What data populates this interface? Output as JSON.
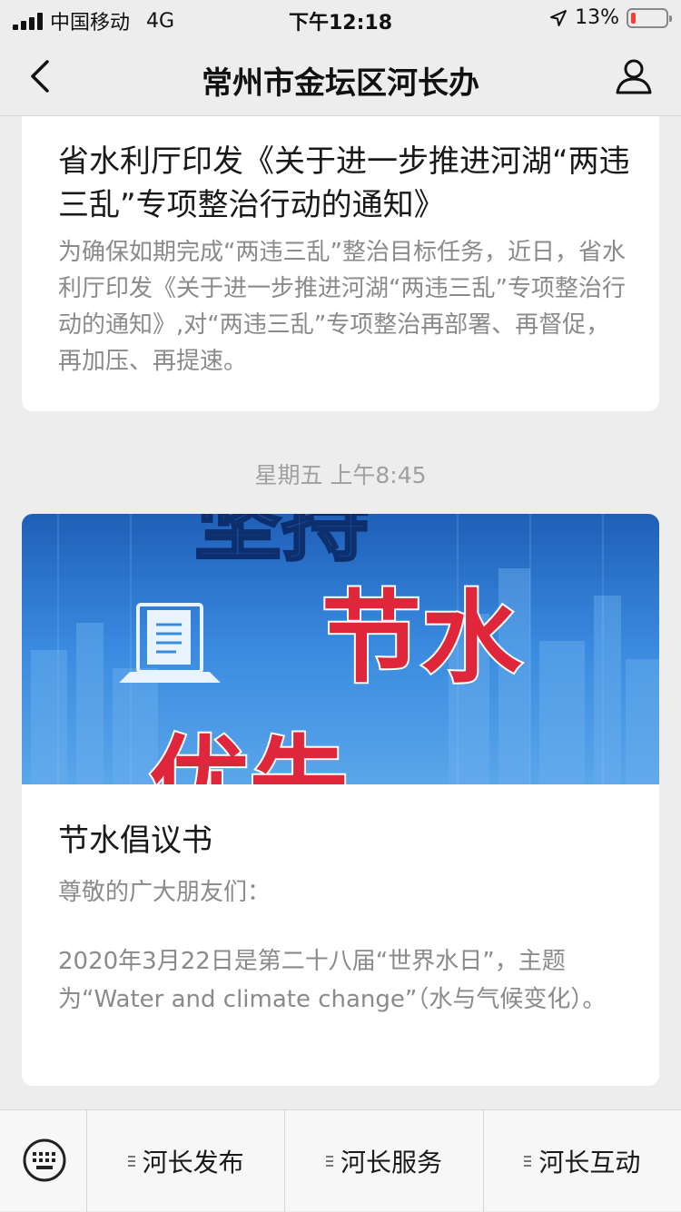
{
  "status_bar": {
    "carrier": "中国移动",
    "network": "4G",
    "time": "下午12:18",
    "battery": "13%",
    "battery_level": 0.13
  },
  "nav": {
    "title": "常州市金坛区河长办",
    "back_icon": "chevron-left-icon",
    "profile_icon": "person-icon"
  },
  "messages": [
    {
      "headline": "省水利厅印发《关于进一步推进河湖“两违三乱”专项整治行动的通知》",
      "summary": "为确保如期完成“两违三乱”整治目标任务，近日，省水利厅印发《关于进一步推进河湖“两违三乱”专项整治行动的通知》,对“两违三乱”专项整治再部署、再督促，再加压、再提速。"
    },
    {
      "timestamp": "星期五 上午8:45",
      "banner_text": [
        "坚持",
        "节水",
        "优先"
      ],
      "title": "节水倡议书",
      "greeting": "尊敬的广大朋友们：",
      "body": "2020年3月22日是第二十八届“世界水日”，主题为“Water and climate change”（水与气候变化）。"
    }
  ],
  "tab_bar": {
    "keyboard_icon": "keyboard-icon",
    "menus": [
      {
        "label": "河长发布"
      },
      {
        "label": "河长服务"
      },
      {
        "label": "河长互动"
      }
    ]
  },
  "colors": {
    "background": "#ededed",
    "card": "#ffffff",
    "banner_blue": "#2f7fd6",
    "banner_red": "#e0263a",
    "battery_low": "#ff3b30"
  }
}
